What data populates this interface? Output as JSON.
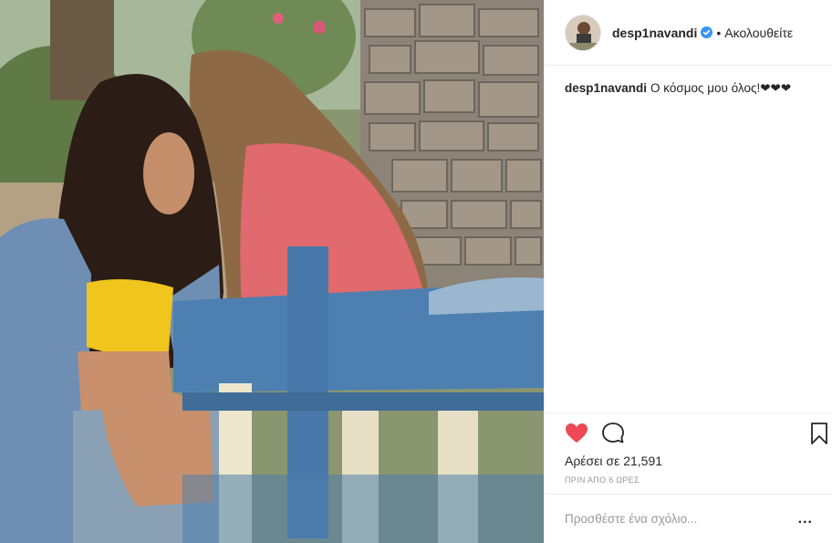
{
  "post": {
    "username": "desp1navandi",
    "verified": true,
    "follow_separator": "•",
    "follow_label": "Ακολουθείτε",
    "caption_user": "desp1navandi",
    "caption_text": "Ο κόσμος μου όλος!❤❤❤",
    "likes_text": "Αρέσει σε 21,591",
    "timestamp": "ΠΡΙΝ ΑΠΟ 6 ΩΡΕΣ",
    "comment_placeholder": "Προσθέστε ένα σχόλιο...",
    "more_label": "..."
  },
  "icons": {
    "like": "heart-icon",
    "comment": "comment-bubble-icon",
    "save": "bookmark-icon",
    "verified": "verified-badge-icon"
  },
  "colors": {
    "heart": "#ed4956",
    "verified": "#3897f0",
    "muted": "#999999",
    "text": "#262626"
  }
}
